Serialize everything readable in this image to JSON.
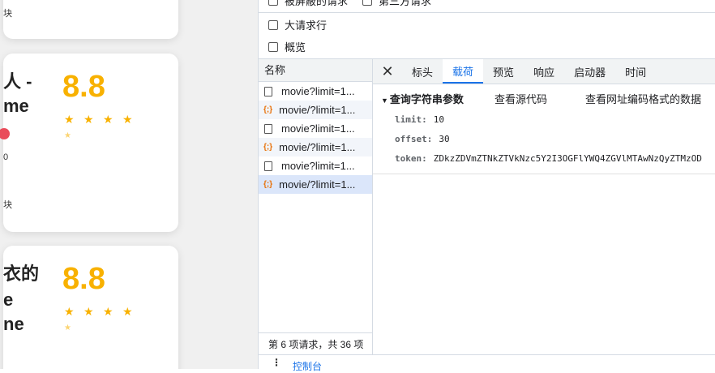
{
  "page": {
    "cards": [
      {
        "title_line1": "人 -",
        "title_line2": "me",
        "score": "8.8",
        "small1": "0",
        "small2": "块"
      },
      {
        "title_line1": "衣的",
        "title_line2": "e",
        "title_line3": "ne",
        "score": "8.8"
      }
    ],
    "top_small": "块"
  },
  "devtools": {
    "filters": {
      "blocked": "被屏蔽的请求",
      "third_party": "第三方请求",
      "large_rows": "大请求行",
      "overview": "概览"
    },
    "list_header": "名称",
    "requests": [
      {
        "name": "movie?limit=1...",
        "type": "doc"
      },
      {
        "name": "movie/?limit=1...",
        "type": "json"
      },
      {
        "name": "movie?limit=1...",
        "type": "doc"
      },
      {
        "name": "movie/?limit=1...",
        "type": "json"
      },
      {
        "name": "movie?limit=1...",
        "type": "doc"
      },
      {
        "name": "movie/?limit=1...",
        "type": "json"
      }
    ],
    "list_footer": "第 6 项请求，共 36 项",
    "tabs": [
      "标头",
      "载荷",
      "预览",
      "响应",
      "启动器",
      "时间"
    ],
    "active_tab": "载荷",
    "payload": {
      "section_title": "查询字符串参数",
      "view_source": "查看源代码",
      "view_encoded": "查看网址编码格式的数据",
      "params": [
        {
          "key": "limit:",
          "value": "10"
        },
        {
          "key": "offset:",
          "value": "30"
        },
        {
          "key": "token:",
          "value": "ZDkzZDVmZTNkZTVkNzc5Y2I3OGFlYWQ4ZGVlMTAwNzQyZTMzOD"
        }
      ]
    },
    "console_label": "控制台"
  }
}
